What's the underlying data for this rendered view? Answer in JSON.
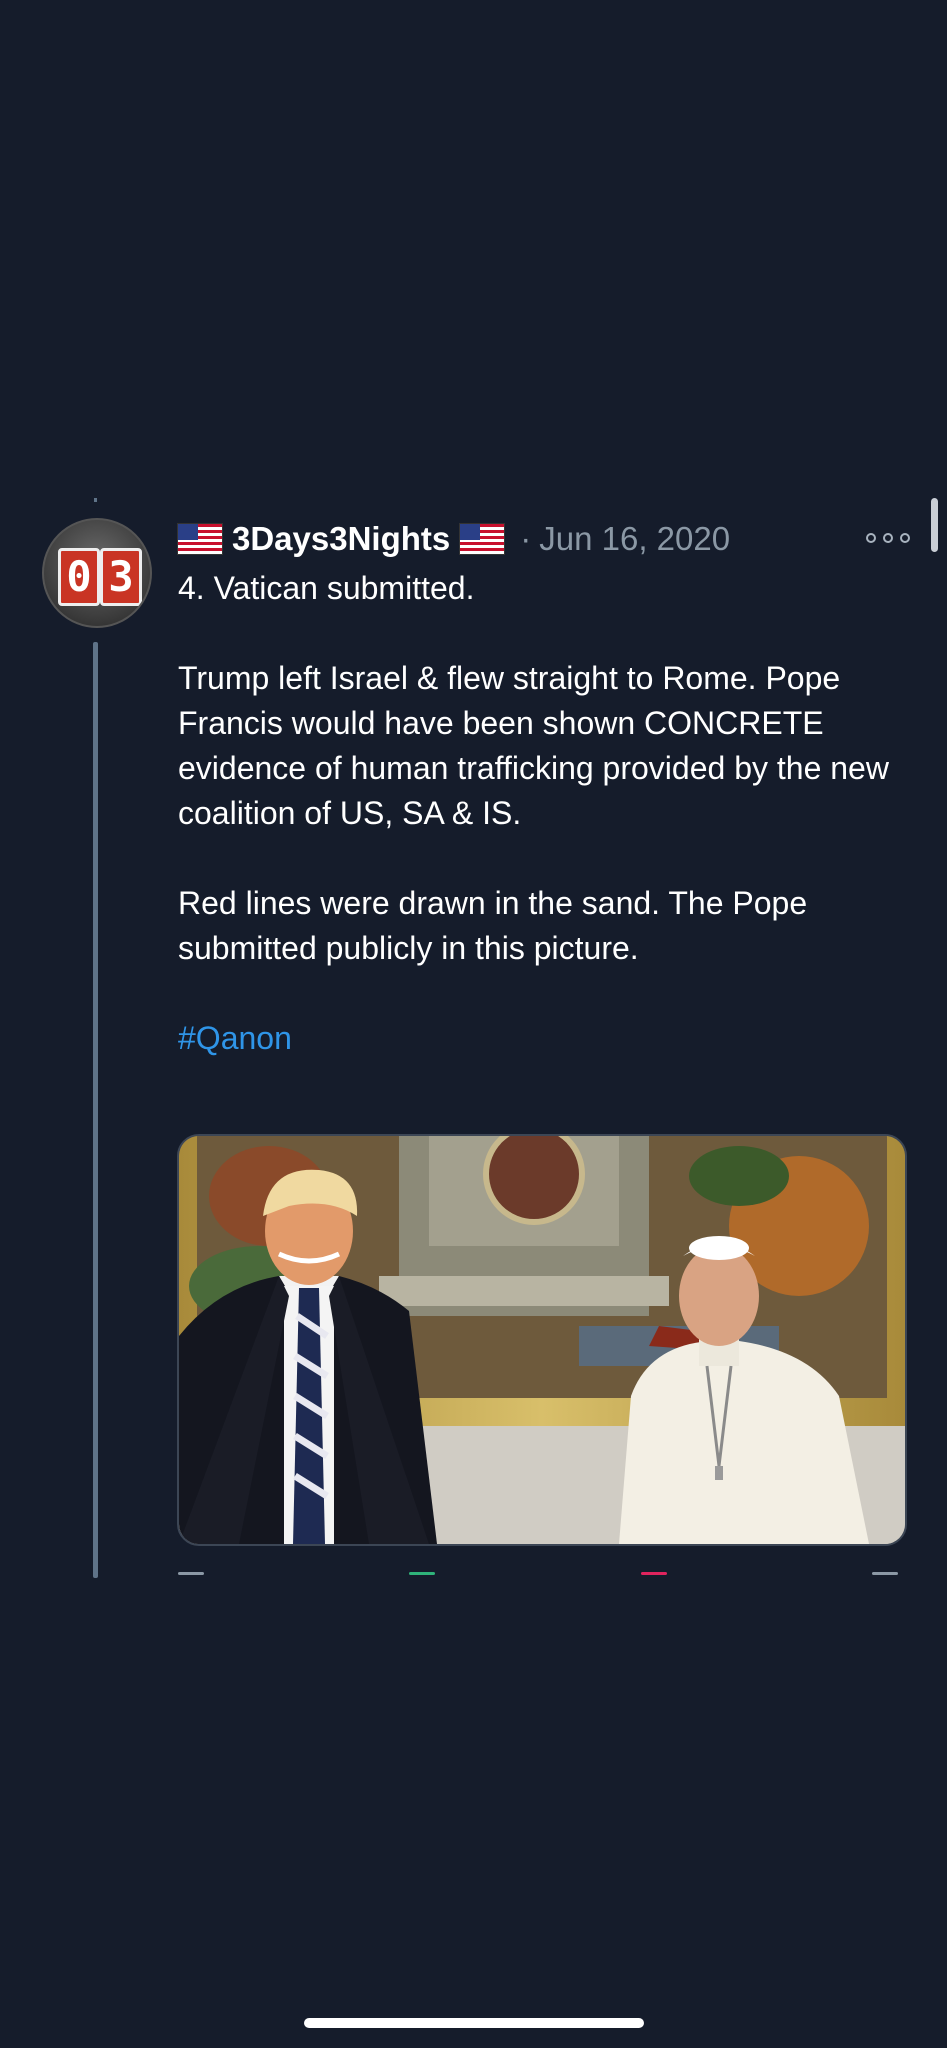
{
  "tweet": {
    "avatar_digits": [
      "0",
      "3"
    ],
    "author_name": "3Days3Nights",
    "separator": "·",
    "date": "Jun 16, 2020",
    "paragraphs": [
      "4. Vatican submitted.",
      "Trump left Israel & flew straight to Rome. Pope Francis would have been shown CONCRETE evidence of human trafficking provided by the new coalition of US, SA & IS.",
      "Red lines were drawn in the sand. The Pope submitted publicly in this picture."
    ],
    "hashtag": "#Qanon",
    "media_alt": "Photo of Donald Trump and Pope Francis standing side by side in the Vatican",
    "icons": {
      "flag": "us-flag-icon",
      "more": "more-options-icon"
    },
    "colors": {
      "background": "#151c2b",
      "hashtag": "#2f95e8",
      "secondary_text": "#8b98a5",
      "thread_line": "#5f7388"
    }
  }
}
